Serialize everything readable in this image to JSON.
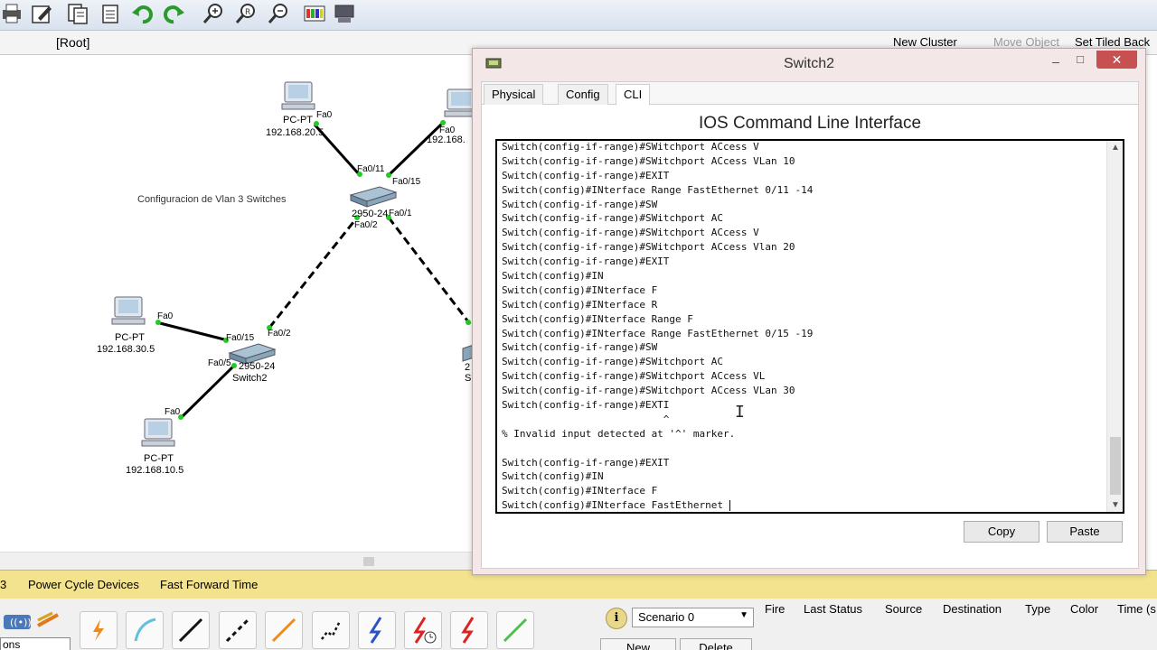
{
  "toolbar": {
    "icons": [
      "print-icon",
      "edit-icon",
      "copy-icon",
      "paste-icon",
      "undo-icon",
      "redo-icon",
      "zoom-in-icon",
      "zoom-reset-icon",
      "zoom-out-icon",
      "palette-icon",
      "device-dialog-icon"
    ]
  },
  "logical_bar": {
    "root": "[Root]",
    "new_cluster": "New Cluster",
    "move_object": "Move Object",
    "set_tiled": "Set Tiled Back"
  },
  "topology": {
    "note": "Configuracion de Vlan 3 Switches",
    "switch_center": {
      "model": "2950-24",
      "port_fa0_11": "Fa0/11",
      "port_fa0_15": "Fa0/15",
      "port_fa0_1": "Fa0/1",
      "port_fa0_2": "Fa0/2"
    },
    "switch_left": {
      "model": "2950-24",
      "name": "Switch2",
      "port_fa0_15": "Fa0/15",
      "port_fa0_2": "Fa0/2",
      "port_fa0_5": "Fa0/5"
    },
    "switch_right": {
      "model": "2",
      "name": "S"
    },
    "pcs": [
      {
        "name": "PC-PT",
        "ip": "192.168.20.5",
        "port": "Fa0"
      },
      {
        "name": "PC-PT",
        "ip": "192.168.",
        "port": "Fa0"
      },
      {
        "name": "PC-PT",
        "ip": "192.168.30.5",
        "port": "Fa0"
      },
      {
        "name": "PC-PT",
        "ip": "192.168.10.5",
        "port": "Fa0"
      }
    ]
  },
  "status_bar": {
    "num": "3",
    "power_cycle": "Power Cycle Devices",
    "fast_forward": "Fast Forward Time"
  },
  "bottom_panel": {
    "ons_text": "ons",
    "info_label": "i",
    "scenario": "Scenario 0",
    "new_label": "New",
    "delete_label": "Delete",
    "pdu_columns": [
      "Fire",
      "Last Status",
      "Source",
      "Destination",
      "Type",
      "Color",
      "Time (s"
    ]
  },
  "dialog": {
    "title": "Switch2",
    "minimize": "–",
    "maximize": "□",
    "close": "✕",
    "tabs": [
      "Physical",
      "Config",
      "CLI"
    ],
    "active_tab": "CLI",
    "heading": "IOS Command Line Interface",
    "terminal_lines": [
      "Switch(config-if-range)#SWitchport ACcess V",
      "Switch(config-if-range)#SWitchport ACcess VLan 10",
      "Switch(config-if-range)#EXIT",
      "Switch(config)#INterface Range FastEthernet 0/11 -14",
      "Switch(config-if-range)#SW",
      "Switch(config-if-range)#SWitchport AC",
      "Switch(config-if-range)#SWitchport ACcess V",
      "Switch(config-if-range)#SWitchport ACcess Vlan 20",
      "Switch(config-if-range)#EXIT",
      "Switch(config)#IN",
      "Switch(config)#INterface F",
      "Switch(config)#INterface R",
      "Switch(config)#INterface Range F",
      "Switch(config)#INterface Range FastEthernet 0/15 -19",
      "Switch(config-if-range)#SW",
      "Switch(config-if-range)#SWitchport AC",
      "Switch(config-if-range)#SWitchport ACcess VL",
      "Switch(config-if-range)#SWitchport ACcess VLan 30",
      "Switch(config-if-range)#EXTI",
      "                           ^",
      "% Invalid input detected at '^' marker.",
      "",
      "Switch(config-if-range)#EXIT",
      "Switch(config)#IN",
      "Switch(config)#INterface F",
      "Switch(config)#INterface FastEthernet "
    ],
    "copy_label": "Copy",
    "paste_label": "Paste"
  }
}
